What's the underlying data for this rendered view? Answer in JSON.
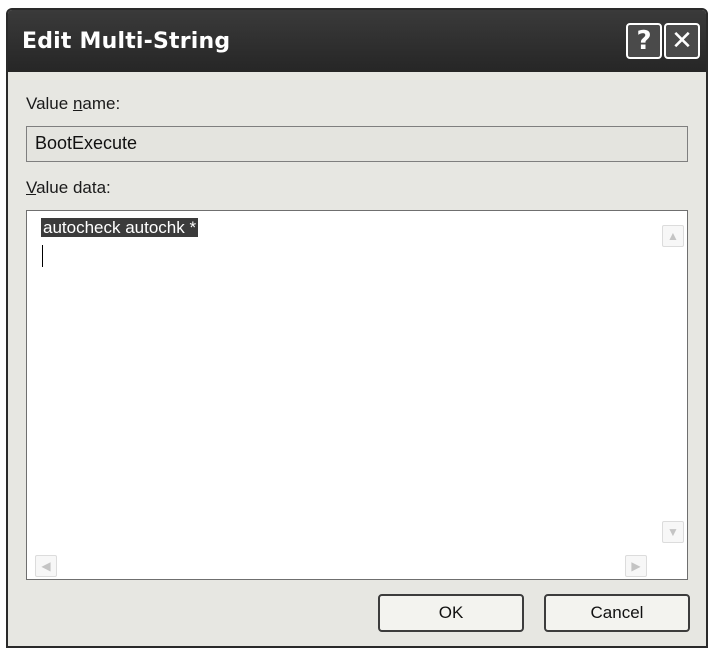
{
  "window": {
    "title": "Edit Multi-String",
    "help_glyph": "?",
    "close_glyph": "✕"
  },
  "value_name": {
    "label_prefix": "Value ",
    "label_accel": "n",
    "label_suffix": "ame:",
    "value": "BootExecute"
  },
  "value_data": {
    "label_accel": "V",
    "label_suffix": "alue data:",
    "lines": [
      "autocheck autochk *"
    ]
  },
  "scroll_arrows": {
    "up": "▲",
    "down": "▼",
    "left": "◀",
    "right": "▶"
  },
  "buttons": {
    "ok": "OK",
    "cancel": "Cancel"
  },
  "icons": [
    "help-icon",
    "close-icon",
    "scroll-up-icon",
    "scroll-down-icon",
    "scroll-left-icon",
    "scroll-right-icon"
  ]
}
